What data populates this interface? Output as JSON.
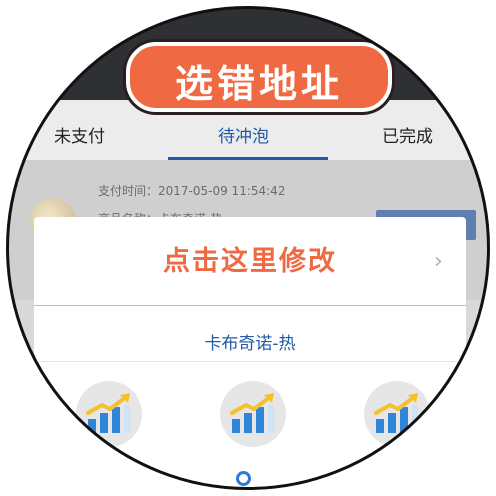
{
  "banner": {
    "text": "选错地址"
  },
  "tabs": [
    {
      "label": "未支付"
    },
    {
      "label": "待冲泡"
    },
    {
      "label": "已完成"
    }
  ],
  "order": {
    "pay_time": "支付时间：2017-05-09 11:54:42",
    "product": "商品名称：卡布奇诺-热"
  },
  "dialog": {
    "title": "点击这里修改",
    "product_name": "卡布奇诺-热"
  },
  "colors": {
    "accent_blue": "#1e5aa8",
    "banner_orange": "#ef6a43",
    "indicator_blue": "#2a7bd6"
  },
  "icons": [
    "chevron-right-icon",
    "chart-arrow-icon"
  ]
}
